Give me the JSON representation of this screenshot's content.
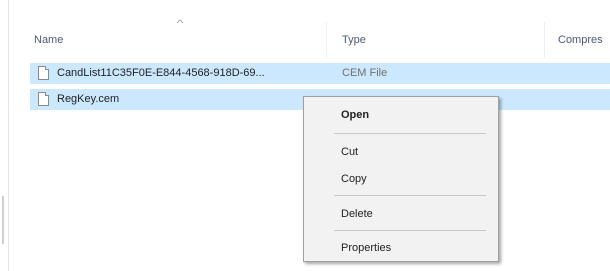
{
  "columns": {
    "name": "Name",
    "type": "Type",
    "compressed": "Compres"
  },
  "files": [
    {
      "name": "CandList11C35F0E-E844-4568-918D-69...",
      "type": "CEM File",
      "icon": "file-icon"
    },
    {
      "name": "RegKey.cem",
      "type": "",
      "icon": "file-icon"
    }
  ],
  "context_menu": {
    "items": [
      {
        "label": "Open",
        "default": true
      },
      {
        "label": "Cut"
      },
      {
        "label": "Copy"
      },
      {
        "label": "Delete"
      },
      {
        "label": "Properties"
      }
    ]
  },
  "colors": {
    "selection": "#cce8ff",
    "menu_bg": "#f2f2f2",
    "header_text": "#4d5a73"
  }
}
